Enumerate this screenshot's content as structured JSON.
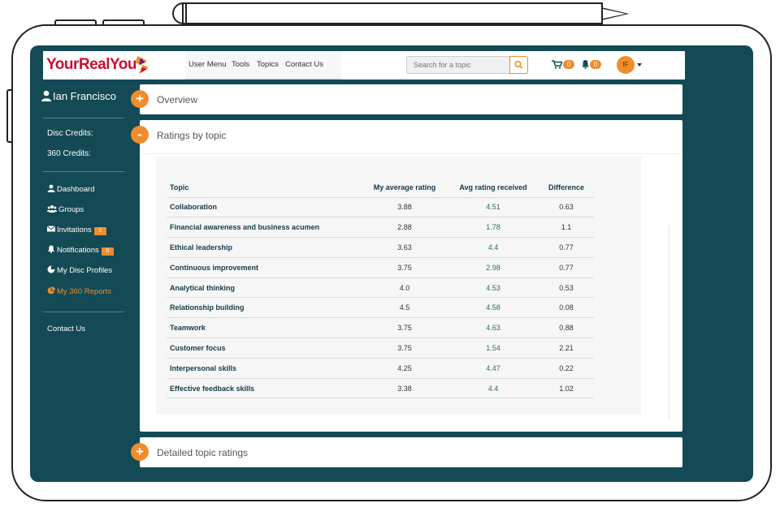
{
  "brand": {
    "name_part1": "YourReal",
    "name_part2": "You"
  },
  "nav": {
    "links": [
      "User Menu",
      "Tools",
      "Topics",
      "Contact Us"
    ],
    "search_placeholder": "Search for a topic",
    "cart_count": "0",
    "notifications_count": "0",
    "avatar_initials": "IF"
  },
  "sidebar": {
    "user_name": "Ian Francisco",
    "disc_credits_label": "Disc Credits:",
    "credits_360_label": "360 Credits:",
    "items": [
      {
        "label": "Dashboard",
        "icon": "user-icon"
      },
      {
        "label": "Groups",
        "icon": "groups-icon"
      },
      {
        "label": "Invitations",
        "icon": "envelope-icon",
        "badge": "0"
      },
      {
        "label": "Notifications",
        "icon": "bell-icon",
        "badge": "0"
      },
      {
        "label": "My Disc Profiles",
        "icon": "pie-icon"
      },
      {
        "label": "My 360 Reports",
        "icon": "chart-pie-icon",
        "active": true
      }
    ],
    "contact_label": "Contact Us"
  },
  "accent_color": "#f08c2b",
  "panels": {
    "overview": {
      "title": "Overview",
      "toggle": "+"
    },
    "ratings": {
      "title": "Ratings by topic",
      "toggle": "-"
    },
    "detailed": {
      "title": "Detailed topic ratings",
      "toggle": "+"
    }
  },
  "ratings_table": {
    "headers": [
      "Topic",
      "My average rating",
      "Avg rating received",
      "Difference"
    ],
    "rows": [
      [
        "Collaboration",
        "3.88",
        "4.51",
        "0.63"
      ],
      [
        "Financial awareness and business acumen",
        "2.88",
        "1.78",
        "1.1"
      ],
      [
        "Ethical leadership",
        "3.63",
        "4.4",
        "0.77"
      ],
      [
        "Continuous improvement",
        "3.75",
        "2.98",
        "0.77"
      ],
      [
        "Analytical thinking",
        "4.0",
        "4.53",
        "0.53"
      ],
      [
        "Relationship building",
        "4.5",
        "4.58",
        "0.08"
      ],
      [
        "Teamwork",
        "3.75",
        "4.63",
        "0.88"
      ],
      [
        "Customer focus",
        "3.75",
        "1.54",
        "2.21"
      ],
      [
        "Interpersonal skills",
        "4.25",
        "4.47",
        "0.22"
      ],
      [
        "Effective feedback skills",
        "3.38",
        "4.4",
        "1.02"
      ]
    ]
  }
}
